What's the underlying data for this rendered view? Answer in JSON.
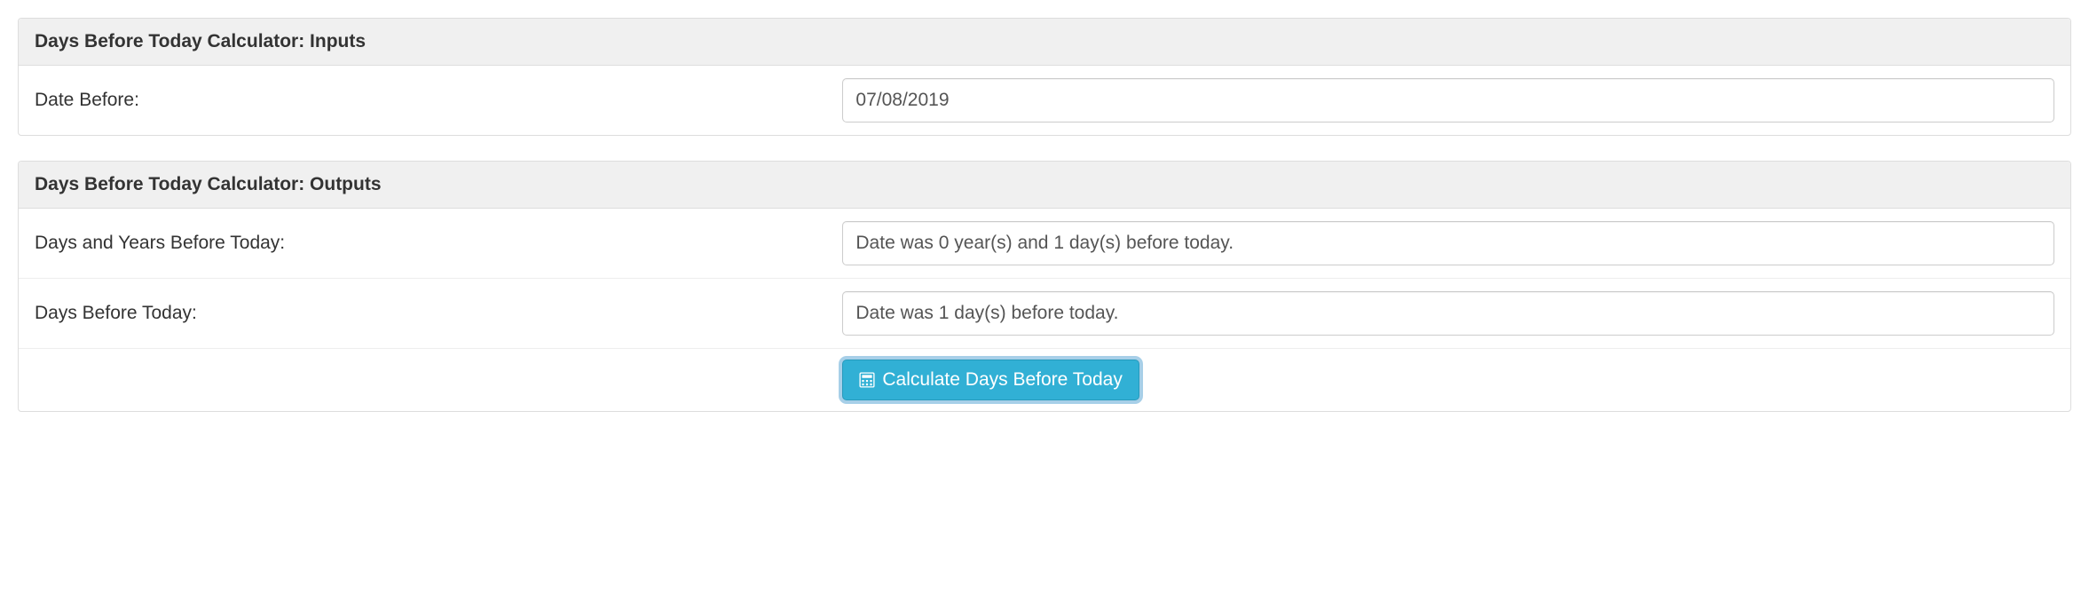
{
  "inputs": {
    "header": "Days Before Today Calculator: Inputs",
    "date_before": {
      "label": "Date Before:",
      "value": "07/08/2019"
    }
  },
  "outputs": {
    "header": "Days Before Today Calculator: Outputs",
    "days_years": {
      "label": "Days and Years Before Today:",
      "value": "Date was 0 year(s) and 1 day(s) before today."
    },
    "days": {
      "label": "Days Before Today:",
      "value": "Date was 1 day(s) before today."
    },
    "button_label": "Calculate Days Before Today"
  }
}
